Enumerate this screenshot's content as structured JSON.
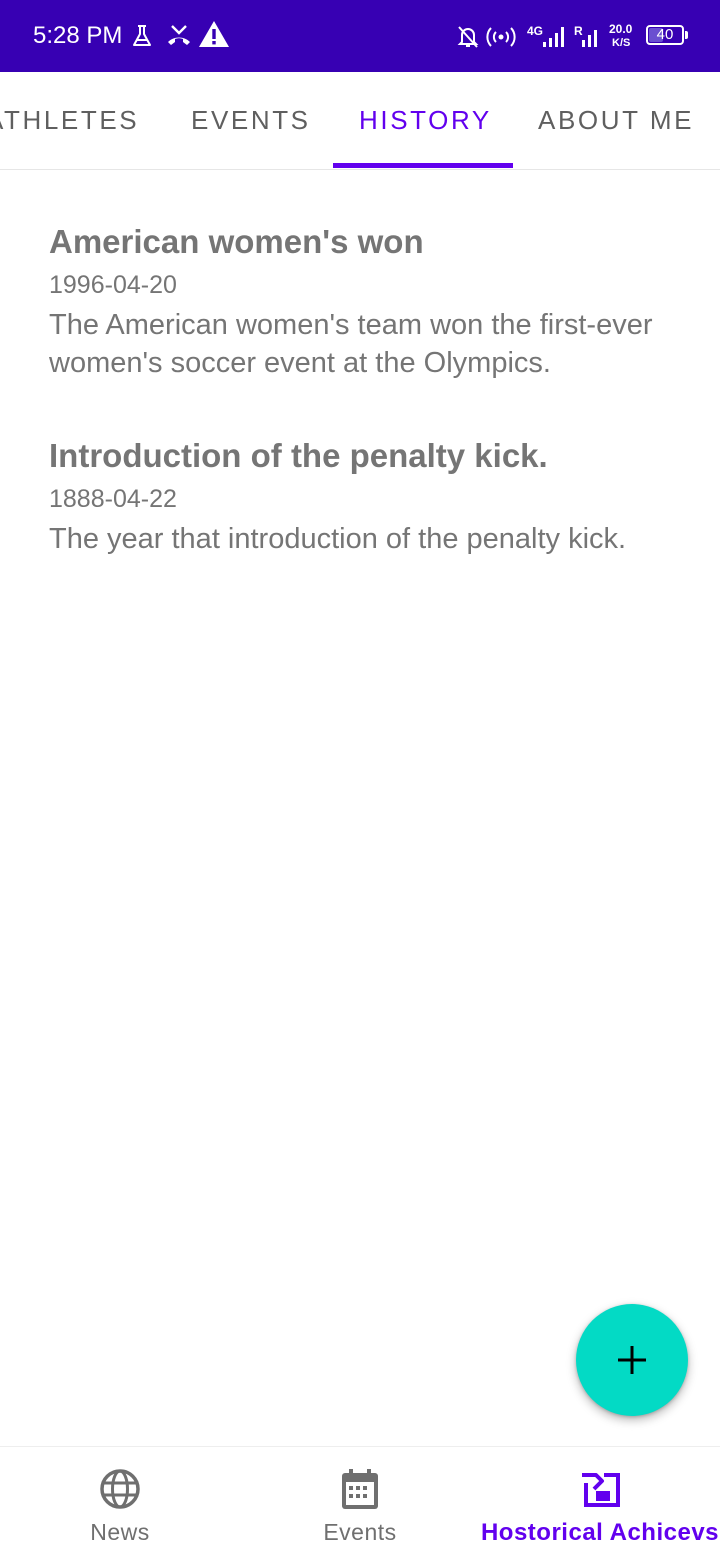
{
  "status_bar": {
    "time": "5:28 PM",
    "network_4g": "4G",
    "roaming": "R",
    "speed_value": "20.0",
    "speed_unit": "K/S",
    "battery": "40",
    "battery_level": 0.4,
    "icons": [
      "flask-icon",
      "missed-call-icon",
      "warning-icon",
      "mute-bell-icon",
      "hotspot-icon",
      "signal-icon",
      "signal-icon-2"
    ],
    "background": "#3700B3"
  },
  "tabs": [
    {
      "label": "ATHLETES",
      "active": false
    },
    {
      "label": "EVENTS",
      "active": false
    },
    {
      "label": "HISTORY",
      "active": true
    },
    {
      "label": "ABOUT ME",
      "active": false
    }
  ],
  "history": [
    {
      "title": "American women's won",
      "date": "1996-04-20",
      "description": "The American women's team won the first-ever women's soccer event at the Olympics."
    },
    {
      "title": "Introduction of the penalty kick.",
      "date": "1888-04-22",
      "description": "The year that introduction of the penalty kick."
    }
  ],
  "fab": {
    "icon": "plus-icon",
    "color": "#03DAC5"
  },
  "bottom_nav": [
    {
      "label": "News",
      "icon": "globe-icon",
      "active": false
    },
    {
      "label": "Events",
      "icon": "calendar-icon",
      "active": false
    },
    {
      "label": "Hostorical Achicevs",
      "icon": "achievement-icon",
      "active": true
    }
  ],
  "colors": {
    "primary": "#6200EE",
    "primary_dark": "#3700B3",
    "accent": "#03DAC5",
    "text_secondary": "#757575"
  }
}
